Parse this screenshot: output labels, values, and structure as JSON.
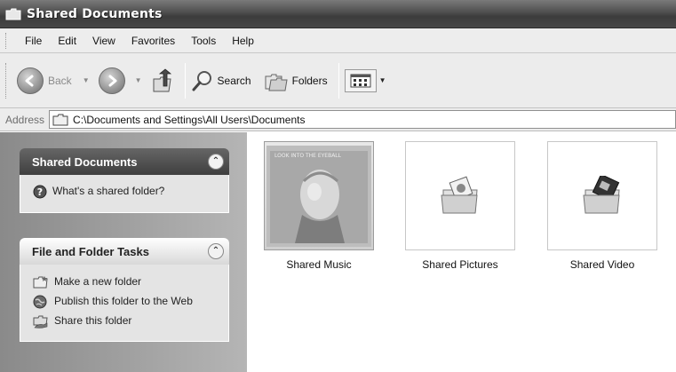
{
  "window": {
    "title": "Shared Documents"
  },
  "menubar": {
    "items": [
      "File",
      "Edit",
      "View",
      "Favorites",
      "Tools",
      "Help"
    ]
  },
  "toolbar": {
    "back_label": "Back",
    "search_label": "Search",
    "folders_label": "Folders"
  },
  "address": {
    "label": "Address",
    "path": "C:\\Documents and Settings\\All Users\\Documents"
  },
  "sidebar": {
    "panel1": {
      "title": "Shared Documents",
      "tasks": [
        "What's a shared folder?"
      ]
    },
    "panel2": {
      "title": "File and Folder Tasks",
      "tasks": [
        "Make a new folder",
        "Publish this folder to the Web",
        "Share this folder"
      ]
    }
  },
  "items": [
    {
      "label": "Shared Music",
      "icon": "album-cover-folder-icon"
    },
    {
      "label": "Shared Pictures",
      "icon": "pictures-folder-icon"
    },
    {
      "label": "Shared Video",
      "icon": "video-folder-icon"
    }
  ]
}
